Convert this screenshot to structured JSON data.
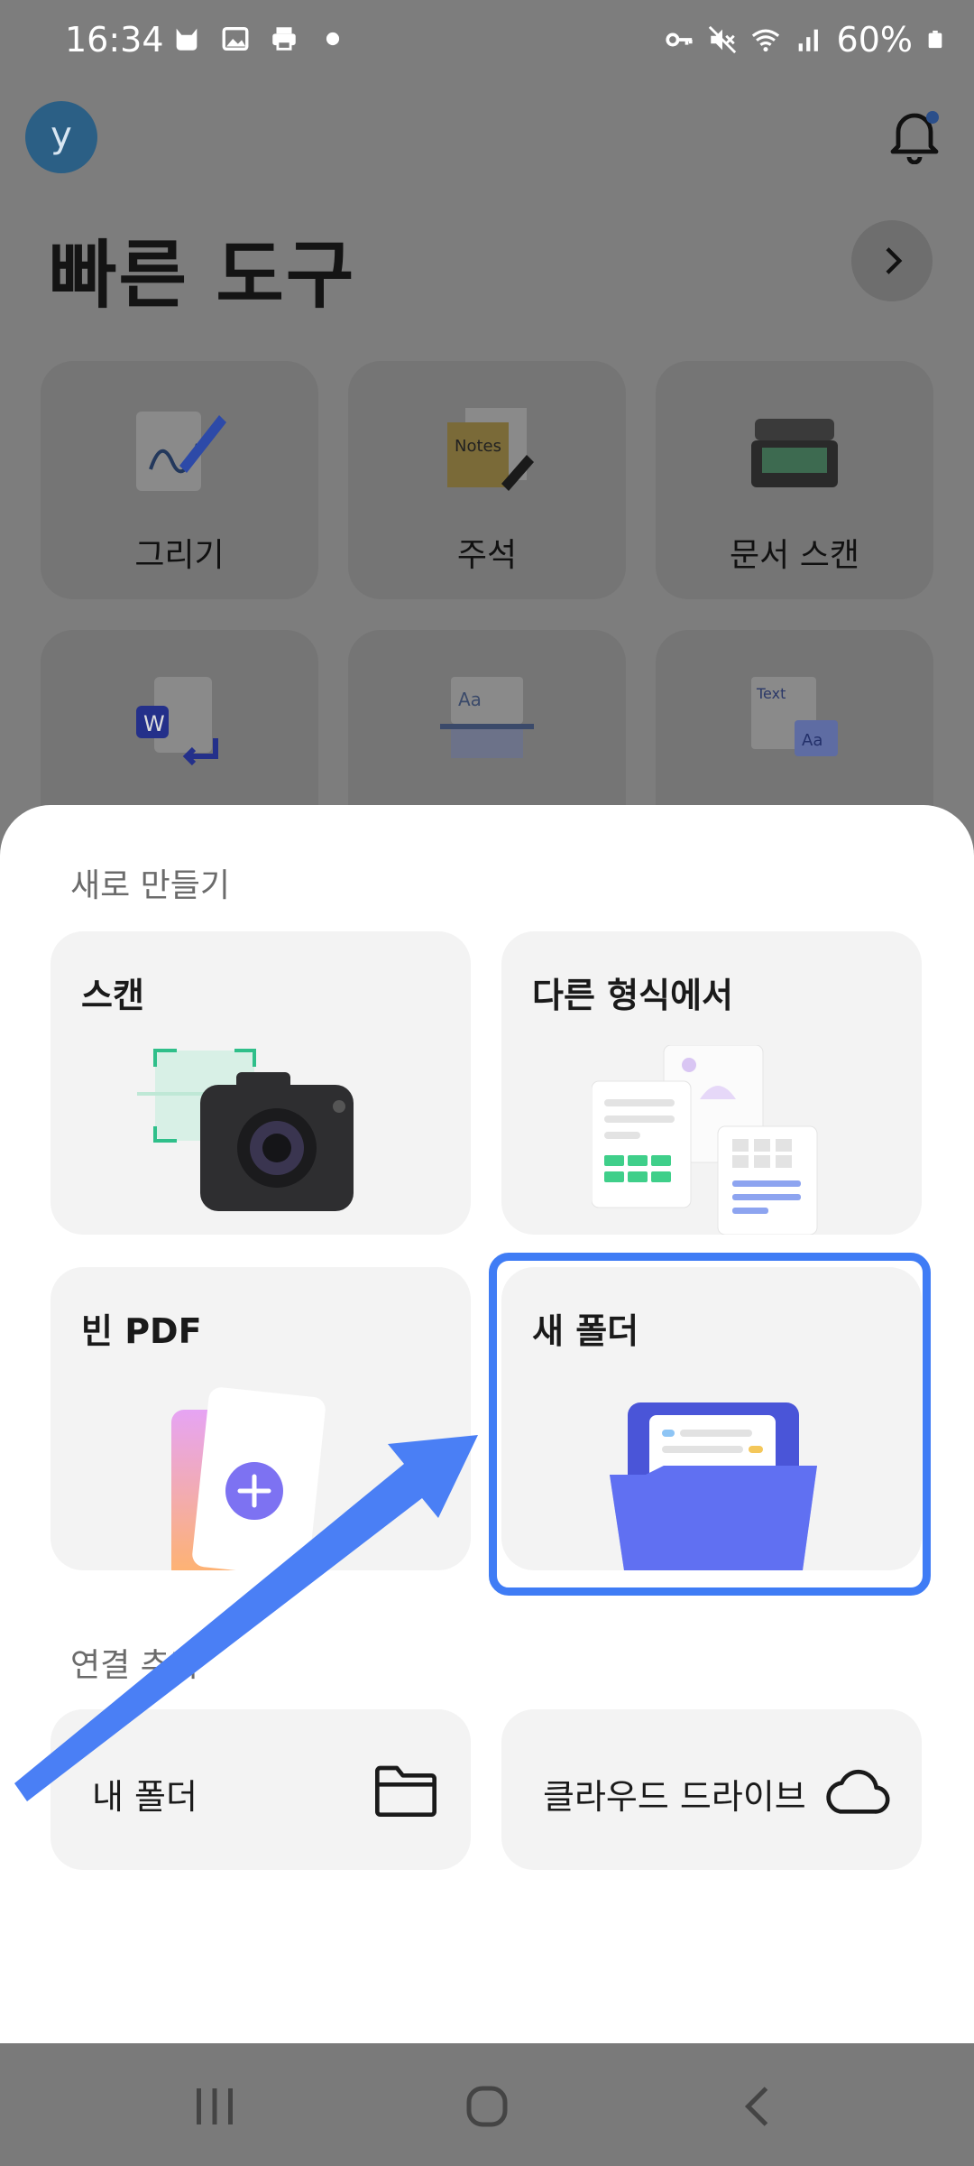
{
  "status_bar": {
    "time": "16:34",
    "battery": "60%",
    "left_icons": [
      "cat-icon",
      "image-icon",
      "printer-icon",
      "dot-icon"
    ],
    "right_icons": [
      "key-icon",
      "mute-icon",
      "wifi-icon",
      "signal-icon",
      "battery-icon"
    ]
  },
  "header": {
    "avatar_letter": "y",
    "title": "빠른 도구"
  },
  "tools": [
    {
      "label": "그리기",
      "icon": "draw-icon"
    },
    {
      "label": "주석",
      "icon": "notes-icon"
    },
    {
      "label": "문서 스캔",
      "icon": "scanner-icon"
    },
    {
      "label": "",
      "icon": "word-convert-icon"
    },
    {
      "label": "",
      "icon": "ocr-icon"
    },
    {
      "label": "",
      "icon": "text-aa-icon"
    }
  ],
  "tool_art_text": {
    "notes": "Notes",
    "text": "Text",
    "aa": "Aa",
    "w": "W"
  },
  "sheet": {
    "create_title": "새로 만들기",
    "cards": [
      {
        "label": "스캔",
        "icon": "camera-scan-icon"
      },
      {
        "label": "다른 형식에서",
        "icon": "documents-icon"
      },
      {
        "label": "빈 PDF",
        "icon": "blank-pdf-icon"
      },
      {
        "label": "새 폴더",
        "icon": "folder-icon"
      }
    ],
    "connect_title": "연결 추가",
    "links": [
      {
        "label": "내 폴더",
        "icon": "folder-outline-icon"
      },
      {
        "label": "클라우드 드라이브",
        "icon": "cloud-icon"
      }
    ]
  },
  "colors": {
    "highlight": "#3f7cf5",
    "annotation_arrow": "#4a7ff5",
    "folder_blue": "#5b6cf0"
  }
}
